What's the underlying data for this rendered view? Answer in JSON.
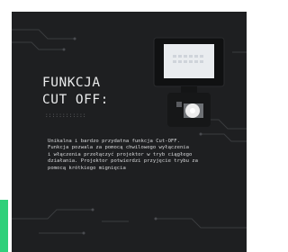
{
  "colors": {
    "background": "#1e1f21",
    "accent": "#2fd07a",
    "text": "#e9eaeb"
  },
  "headline": {
    "line1": "FUNKCJA",
    "line2": "CUT OFF:"
  },
  "decoration": {
    "dots": "::::::::::::"
  },
  "description": {
    "lines": [
      "Unikalna i bardzo przydatna funkcja Cut-OFF.",
      "Funkcja pozwala za pomocą chwilowego wyłączenia",
      "i włączenia przełączyć projektor w tryb ciągłego",
      "działania. Projektor potwierdzi przyjęcie trybu za",
      "pomocą krótkiego mignięcia"
    ]
  },
  "icons": {
    "product": "led-floodlight-with-motion-sensor-image"
  }
}
